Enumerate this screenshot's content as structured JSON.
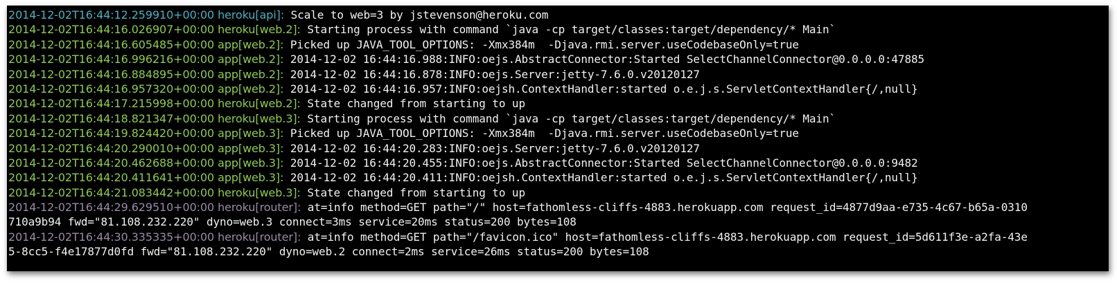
{
  "colors": {
    "api": "#3fb6c6",
    "web2": "#8ecf3c",
    "web3": "#8ecf3c",
    "router": "#9a8aa6",
    "message": "#f2f2f2",
    "background": "#000000"
  },
  "lines": [
    {
      "ts": "2014-12-02T16:44:12.259910+00:00",
      "src": "heroku[api]:",
      "msg": " Scale to web=3 by jstevenson@heroku.com",
      "color": "#3fb6c6"
    },
    {
      "ts": "2014-12-02T16:44:16.026907+00:00",
      "src": "heroku[web.2]:",
      "msg": " Starting process with command `java -cp target/classes:target/dependency/* Main`",
      "color": "#8ecf3c"
    },
    {
      "ts": "2014-12-02T16:44:16.605485+00:00",
      "src": "app[web.2]:",
      "msg": " Picked up JAVA_TOOL_OPTIONS: -Xmx384m  -Djava.rmi.server.useCodebaseOnly=true",
      "color": "#8ecf3c"
    },
    {
      "ts": "2014-12-02T16:44:16.996216+00:00",
      "src": "app[web.2]:",
      "msg": " 2014-12-02 16:44:16.988:INFO:oejs.AbstractConnector:Started SelectChannelConnector@0.0.0.0:47885",
      "color": "#8ecf3c"
    },
    {
      "ts": "2014-12-02T16:44:16.884895+00:00",
      "src": "app[web.2]:",
      "msg": " 2014-12-02 16:44:16.878:INFO:oejs.Server:jetty-7.6.0.v20120127",
      "color": "#8ecf3c"
    },
    {
      "ts": "2014-12-02T16:44:16.957320+00:00",
      "src": "app[web.2]:",
      "msg": " 2014-12-02 16:44:16.957:INFO:oejsh.ContextHandler:started o.e.j.s.ServletContextHandler{/,null}",
      "color": "#8ecf3c"
    },
    {
      "ts": "2014-12-02T16:44:17.215998+00:00",
      "src": "heroku[web.2]:",
      "msg": " State changed from starting to up",
      "color": "#8ecf3c"
    },
    {
      "ts": "2014-12-02T16:44:18.821347+00:00",
      "src": "heroku[web.3]:",
      "msg": " Starting process with command `java -cp target/classes:target/dependency/* Main`",
      "color": "#8ecf3c"
    },
    {
      "ts": "2014-12-02T16:44:19.824420+00:00",
      "src": "app[web.3]:",
      "msg": " Picked up JAVA_TOOL_OPTIONS: -Xmx384m  -Djava.rmi.server.useCodebaseOnly=true",
      "color": "#8ecf3c"
    },
    {
      "ts": "2014-12-02T16:44:20.290010+00:00",
      "src": "app[web.3]:",
      "msg": " 2014-12-02 16:44:20.283:INFO:oejs.Server:jetty-7.6.0.v20120127",
      "color": "#8ecf3c"
    },
    {
      "ts": "2014-12-02T16:44:20.462688+00:00",
      "src": "app[web.3]:",
      "msg": " 2014-12-02 16:44:20.455:INFO:oejs.AbstractConnector:Started SelectChannelConnector@0.0.0.0:9482",
      "color": "#8ecf3c"
    },
    {
      "ts": "2014-12-02T16:44:20.411641+00:00",
      "src": "app[web.3]:",
      "msg": " 2014-12-02 16:44:20.411:INFO:oejsh.ContextHandler:started o.e.j.s.ServletContextHandler{/,null}",
      "color": "#8ecf3c"
    },
    {
      "ts": "2014-12-02T16:44:21.083442+00:00",
      "src": "heroku[web.3]:",
      "msg": " State changed from starting to up",
      "color": "#8ecf3c"
    },
    {
      "ts": "2014-12-02T16:44:29.629510+00:00",
      "src": "heroku[router]:",
      "msg": " at=info method=GET path=\"/\" host=fathomless-cliffs-4883.herokuapp.com request_id=4877d9aa-e735-4c67-b65a-0310",
      "color": "#9a8aa6"
    },
    {
      "ts": "",
      "src": "",
      "msg": "710a9b94 fwd=\"81.108.232.220\" dyno=web.3 connect=3ms service=20ms status=200 bytes=108",
      "color": "#9a8aa6"
    },
    {
      "ts": "2014-12-02T16:44:30.335335+00:00",
      "src": "heroku[router]:",
      "msg": " at=info method=GET path=\"/favicon.ico\" host=fathomless-cliffs-4883.herokuapp.com request_id=5d611f3e-a2fa-43e",
      "color": "#9a8aa6"
    },
    {
      "ts": "",
      "src": "",
      "msg": "5-8cc5-f4e17877d0fd fwd=\"81.108.232.220\" dyno=web.2 connect=2ms service=26ms status=200 bytes=108",
      "color": "#9a8aa6"
    }
  ]
}
